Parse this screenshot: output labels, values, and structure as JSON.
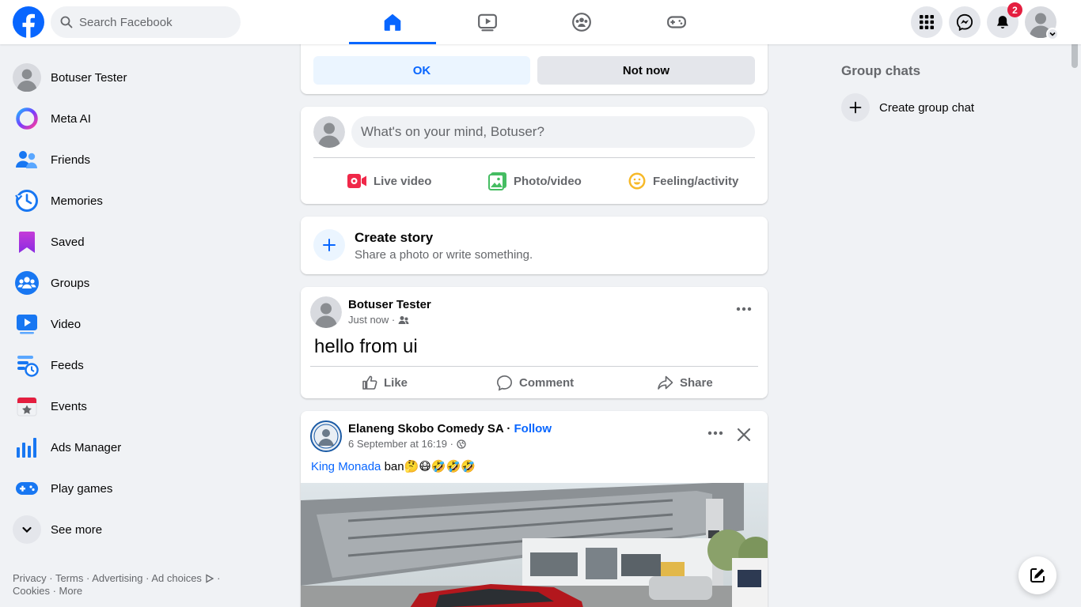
{
  "topbar": {
    "search_placeholder": "Search Facebook",
    "tabs": [
      "home",
      "video",
      "groups",
      "gaming"
    ],
    "active_tab": "home",
    "notifications_count": "2",
    "brand_color": "#0866ff"
  },
  "sidebar": {
    "items": [
      {
        "label": "Botuser Tester",
        "icon": "user-avatar-icon"
      },
      {
        "label": "Meta AI",
        "icon": "meta-ai-icon"
      },
      {
        "label": "Friends",
        "icon": "friends-icon"
      },
      {
        "label": "Memories",
        "icon": "memories-icon"
      },
      {
        "label": "Saved",
        "icon": "saved-icon"
      },
      {
        "label": "Groups",
        "icon": "groups-icon"
      },
      {
        "label": "Video",
        "icon": "video-icon"
      },
      {
        "label": "Feeds",
        "icon": "feeds-icon"
      },
      {
        "label": "Events",
        "icon": "events-icon"
      },
      {
        "label": "Ads Manager",
        "icon": "ads-manager-icon"
      },
      {
        "label": "Play games",
        "icon": "play-games-icon"
      }
    ],
    "see_more": "See more",
    "footer": {
      "privacy": "Privacy",
      "terms": "Terms",
      "advertising": "Advertising",
      "ad_choices": "Ad choices",
      "cookies": "Cookies",
      "more": "More"
    }
  },
  "prompt": {
    "ok_label": "OK",
    "not_now_label": "Not now"
  },
  "composer": {
    "placeholder": "What's on your mind, Botuser?",
    "live_video": "Live video",
    "photo_video": "Photo/video",
    "feeling": "Feeling/activity"
  },
  "story": {
    "title": "Create story",
    "subtitle": "Share a photo or write something."
  },
  "posts": [
    {
      "author": "Botuser Tester",
      "time": "Just now",
      "audience_icon": "friends-audience-icon",
      "text": "hello from ui",
      "like": "Like",
      "comment": "Comment",
      "share": "Share"
    },
    {
      "author": "Elaneng Skobo Comedy SA",
      "follow": "Follow",
      "time": "6 September at 16:19",
      "audience_icon": "globe-icon",
      "mention": "King Monada",
      "caption_rest": " ban🤔😷🤣🤣🤣"
    }
  ],
  "right_column": {
    "title": "Group chats",
    "create_label": "Create group chat"
  }
}
